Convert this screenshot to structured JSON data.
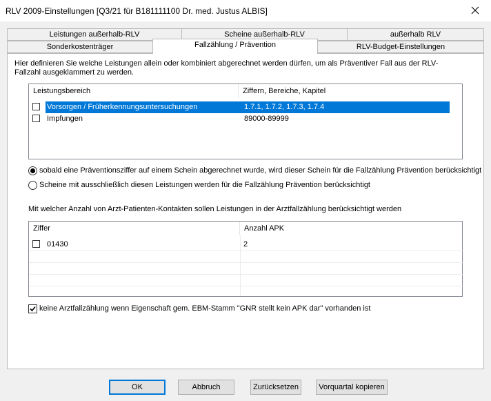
{
  "window": {
    "title": "RLV 2009-Einstellungen  [Q3/21 für B181111100   Dr. med. Justus ALBIS]"
  },
  "tabs": {
    "row1": [
      "Leistungen außerhalb-RLV",
      "Scheine außerhalb-RLV",
      "außerhalb RLV"
    ],
    "row2": [
      "Sonderkostenträger",
      "Fallzählung / Prävention",
      "RLV-Budget-Einstellungen"
    ],
    "active": "Fallzählung / Prävention"
  },
  "description": "Hier definieren Sie welche Leistungen allein oder kombiniert abgerechnet werden dürfen, um als Präventiver Fall aus der RLV-Fallzahl ausgeklammert zu werden.",
  "leistungen_list": {
    "columns": [
      "Leistungsbereich",
      "Ziffern, Bereiche, Kapitel"
    ],
    "rows": [
      {
        "name": "Vorsorgen / Früherkennungsuntersuchungen",
        "ziffern": "1.7.1, 1.7.2, 1.7.3, 1.7.4",
        "checked": false,
        "selected": true
      },
      {
        "name": "Impfungen",
        "ziffern": "89000-89999",
        "checked": false,
        "selected": false
      }
    ]
  },
  "radio_options": {
    "option1": "sobald eine Präventionsziffer auf einem Schein abgerechnet wurde, wird dieser Schein für die Fallzählung Prävention berücksichtigt",
    "option2": "Scheine mit ausschließlich diesen Leistungen werden für die Fallzählung Prävention berücksichtigt",
    "selected": "option1"
  },
  "apk_heading": "Mit welcher Anzahl von Arzt-Patienten-Kontakten sollen Leistungen in der Arztfallzählung berücksichtigt werden",
  "apk_list": {
    "columns": [
      "Ziffer",
      "Anzahl APK"
    ],
    "rows": [
      {
        "ziffer": "01430",
        "anzahl": "2",
        "checked": false
      }
    ]
  },
  "ebm_checkbox": {
    "label": "keine Arztfallzählung wenn Eigenschaft gem. EBM-Stamm \"GNR stellt kein APK dar\" vorhanden ist",
    "checked": true
  },
  "buttons": {
    "ok": "OK",
    "cancel": "Abbruch",
    "reset": "Zurücksetzen",
    "copy": "Vorquartal kopieren"
  }
}
